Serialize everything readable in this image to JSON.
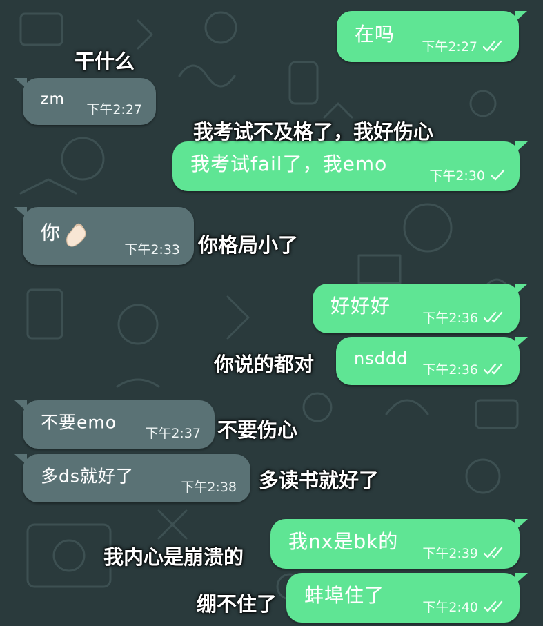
{
  "messages": [
    {
      "text": "在吗",
      "time": "下午2:27",
      "status": "read"
    },
    {
      "text": "zm",
      "time": "下午2:27"
    },
    {
      "text": "我考试fail了，我emo",
      "time": "下午2:30",
      "status": "sent"
    },
    {
      "text": "你",
      "time": "下午2:33",
      "emoji": "pinched-fingers-emoji"
    },
    {
      "text": "好好好",
      "time": "下午2:36",
      "status": "read"
    },
    {
      "text": "nsddd",
      "time": "下午2:36",
      "status": "read"
    },
    {
      "text": "不要emo",
      "time": "下午2:37"
    },
    {
      "text": "多ds就好了",
      "time": "下午2:38"
    },
    {
      "text": "我nx是bk的",
      "time": "下午2:39",
      "status": "read"
    },
    {
      "text": "蚌埠住了",
      "time": "下午2:40",
      "status": "read"
    }
  ],
  "captions": [
    "干什么",
    "我考试不及格了，我好伤心",
    "你格局小了",
    "你说的都对",
    "不要伤心",
    "多读书就好了",
    "我内心是崩溃的",
    "绷不住了"
  ],
  "colors": {
    "background": "#2a3a3c",
    "outgoing_bubble": "#5fe594",
    "incoming_bubble": "#5a7275",
    "doodle": "#3d5052"
  }
}
